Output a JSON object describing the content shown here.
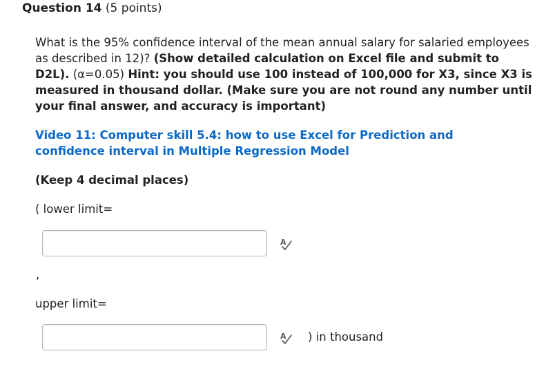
{
  "question": {
    "title": "Question 14",
    "points": " (5 points)"
  },
  "body": {
    "text1": "What is the 95% confidence interval of the mean annual salary for salaried employees as described in 12)? ",
    "bold1": "(Show detailed calculation on Excel file and submit to D2L).",
    "text2": " (α=0.05) ",
    "bold2": "Hint: you should use 100 instead of 100,000 for X3, since X3 is measured in thousand dollar. (Make sure you are not round any number until your final answer, and accuracy is important)"
  },
  "video_link": "Video 11: Computer skill 5.4: how to use Excel for Prediction and confidence interval in Multiple Regression Model",
  "keep_places": "(Keep 4 decimal places)",
  "lower": {
    "label": "( lower limit=",
    "value": "",
    "spellcheck_icon": "spellcheck-icon"
  },
  "separator": ",",
  "upper": {
    "label": "upper limit=",
    "value": "",
    "spellcheck_icon": "spellcheck-icon"
  },
  "suffix": ") in thousand",
  "colors": {
    "link": "#0b69c7",
    "text": "#222222",
    "input_border": "#b5b5b5"
  }
}
